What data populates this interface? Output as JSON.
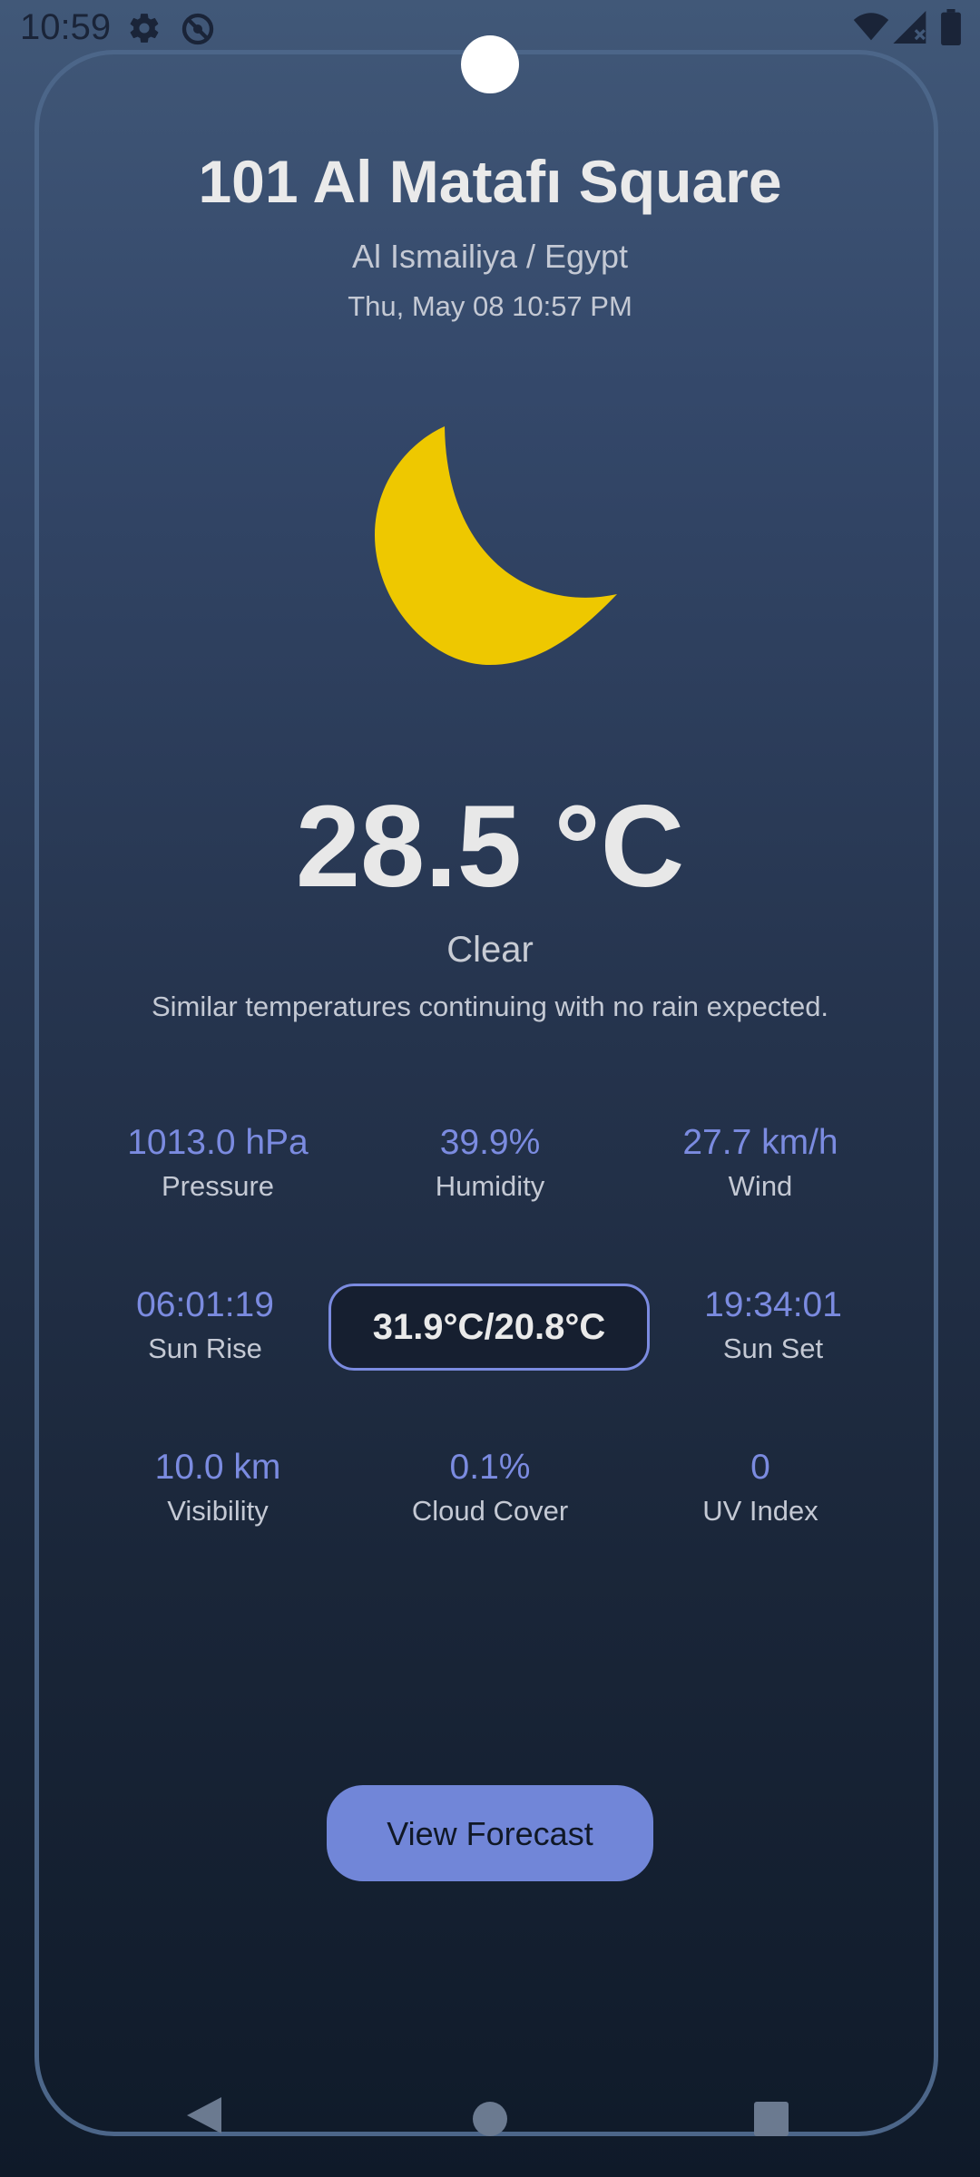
{
  "status_bar": {
    "time": "10:59",
    "icons": [
      "settings-icon",
      "do-not-disturb-icon",
      "wifi-icon",
      "signal-icon",
      "battery-icon"
    ]
  },
  "location": {
    "title": "101 Al Matafı Square",
    "region": "Al Ismailiya / Egypt",
    "datetime": "Thu, May 08 10:57 PM"
  },
  "weather": {
    "icon": "moon-icon",
    "temperature": "28.5 °C",
    "condition": "Clear",
    "summary": "Similar temperatures continuing with no rain expected."
  },
  "stats": {
    "pressure": {
      "value": "1013.0 hPa",
      "label": "Pressure"
    },
    "humidity": {
      "value": "39.9%",
      "label": "Humidity"
    },
    "wind": {
      "value": "27.7 km/h",
      "label": "Wind"
    },
    "sunrise": {
      "value": "06:01:19",
      "label": "Sun Rise"
    },
    "minmax": "31.9°C/20.8°C",
    "sunset": {
      "value": "19:34:01",
      "label": "Sun Set"
    },
    "visibility": {
      "value": "10.0 km",
      "label": "Visibility"
    },
    "cloud_cover": {
      "value": "0.1%",
      "label": "Cloud Cover"
    },
    "uv_index": {
      "value": "0",
      "label": "UV Index"
    }
  },
  "actions": {
    "forecast_label": "View Forecast"
  },
  "colors": {
    "accent": "#7b8be0",
    "button": "#7186d8",
    "moon": "#eec800",
    "background_top": "#415878",
    "background_bottom": "#0f1a29"
  }
}
